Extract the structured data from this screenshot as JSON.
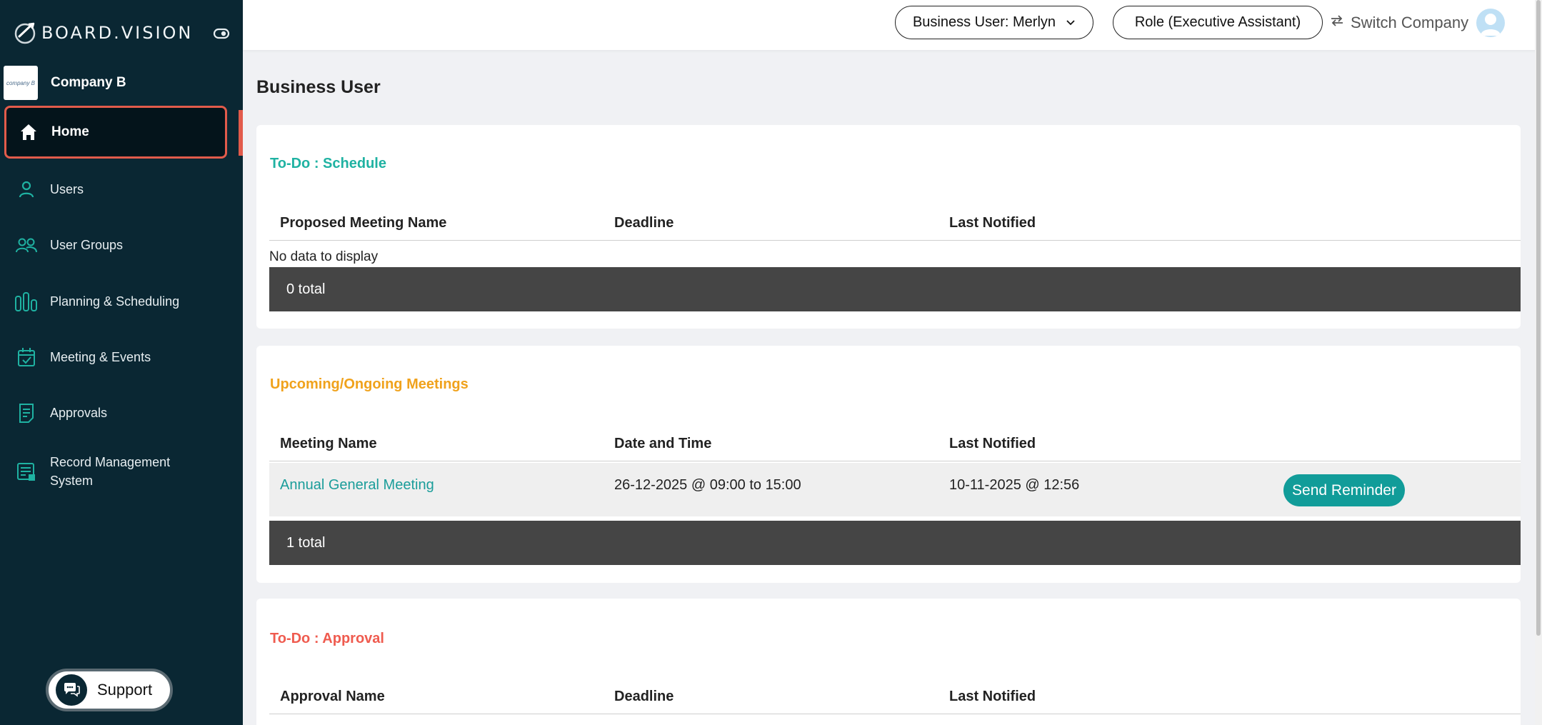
{
  "brand": {
    "name": "BOARD.VISION"
  },
  "company": {
    "name": "Company B",
    "logo_text": "company B"
  },
  "sidebar": {
    "items": [
      {
        "label": "Home",
        "icon": "home-icon",
        "active": true
      },
      {
        "label": "Users",
        "icon": "user-icon"
      },
      {
        "label": "User Groups",
        "icon": "user-group-icon"
      },
      {
        "label": "Planning & Scheduling",
        "icon": "bar-chart-icon"
      },
      {
        "label": "Meeting & Events",
        "icon": "calendar-check-icon"
      },
      {
        "label": "Approvals",
        "icon": "approval-document-icon"
      },
      {
        "label": "Record Management",
        "label_line2": "System",
        "icon": "record-icon"
      }
    ],
    "support_label": "Support"
  },
  "header": {
    "business_user": "Business User: Merlyn",
    "role": "Role (Executive Assistant)",
    "switch_company": "Switch Company"
  },
  "page": {
    "title": "Business User"
  },
  "todo_schedule": {
    "title": "To-Do : Schedule",
    "columns": [
      "Proposed Meeting Name",
      "Deadline",
      "Last Notified"
    ],
    "empty_text": "No data to display",
    "total": "0 total"
  },
  "upcoming": {
    "title": "Upcoming/Ongoing Meetings",
    "columns": [
      "Meeting Name",
      "Date and Time",
      "Last Notified"
    ],
    "rows": [
      {
        "name": "Annual General Meeting",
        "datetime": "26-12-2025 @ 09:00 to 15:00",
        "last_notified": "10-11-2025 @ 12:56",
        "action": "Send Reminder"
      }
    ],
    "total": "1 total"
  },
  "todo_approval": {
    "title": "To-Do : Approval",
    "columns": [
      "Approval Name",
      "Deadline",
      "Last Notified"
    ]
  },
  "colors": {
    "sidebar_bg": "#0a2733",
    "accent_teal": "#1fb2a2",
    "accent_orange": "#f0a21c",
    "accent_red": "#ef5b4f",
    "active_border": "#e25b4b",
    "button_teal": "#119c99"
  }
}
